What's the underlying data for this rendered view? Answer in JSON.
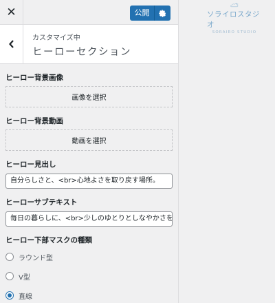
{
  "topbar": {
    "close_icon": "close-icon",
    "publish_label": "公開",
    "publish_gear_icon": "gear-icon",
    "publish_color": "#2271b1"
  },
  "section": {
    "subtitle": "カスタマイズ中",
    "title": "ヒーローセクション",
    "back_icon": "chevron-left-icon"
  },
  "controls": {
    "bg_image": {
      "label": "ヒーロー背景画像",
      "button": "画像を選択"
    },
    "bg_video": {
      "label": "ヒーロー背景動画",
      "button": "動画を選択"
    },
    "heading": {
      "label": "ヒーロー見出し",
      "value": "自分らしさと、<br>心地よさを取り戻す場所。"
    },
    "subtext": {
      "label": "ヒーローサブテキスト",
      "value": "毎日の暮らしに、<br>少しのゆとりとしなやかさを"
    },
    "mask": {
      "label": "ヒーロー下部マスクの種類",
      "options": [
        {
          "label": "ラウンド型",
          "checked": false
        },
        {
          "label": "V型",
          "checked": false
        },
        {
          "label": "直線",
          "checked": true
        }
      ]
    }
  },
  "preview": {
    "logo_text": "ソライロスタジオ",
    "logo_sub": "SORAIRO STUDIO",
    "logo_icon": "cloud-sun-logo-icon"
  }
}
